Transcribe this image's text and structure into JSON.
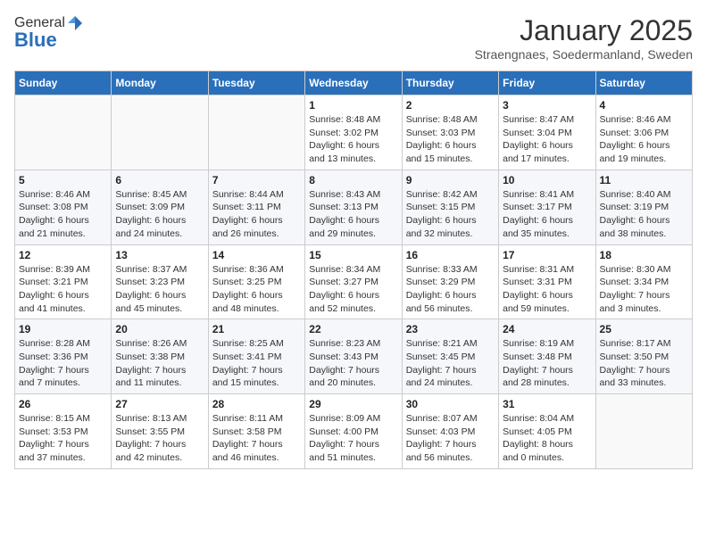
{
  "logo": {
    "general": "General",
    "blue": "Blue"
  },
  "title": "January 2025",
  "location": "Straengnaes, Soedermanland, Sweden",
  "weekdays": [
    "Sunday",
    "Monday",
    "Tuesday",
    "Wednesday",
    "Thursday",
    "Friday",
    "Saturday"
  ],
  "weeks": [
    [
      {
        "day": "",
        "info": ""
      },
      {
        "day": "",
        "info": ""
      },
      {
        "day": "",
        "info": ""
      },
      {
        "day": "1",
        "info": "Sunrise: 8:48 AM\nSunset: 3:02 PM\nDaylight: 6 hours\nand 13 minutes."
      },
      {
        "day": "2",
        "info": "Sunrise: 8:48 AM\nSunset: 3:03 PM\nDaylight: 6 hours\nand 15 minutes."
      },
      {
        "day": "3",
        "info": "Sunrise: 8:47 AM\nSunset: 3:04 PM\nDaylight: 6 hours\nand 17 minutes."
      },
      {
        "day": "4",
        "info": "Sunrise: 8:46 AM\nSunset: 3:06 PM\nDaylight: 6 hours\nand 19 minutes."
      }
    ],
    [
      {
        "day": "5",
        "info": "Sunrise: 8:46 AM\nSunset: 3:08 PM\nDaylight: 6 hours\nand 21 minutes."
      },
      {
        "day": "6",
        "info": "Sunrise: 8:45 AM\nSunset: 3:09 PM\nDaylight: 6 hours\nand 24 minutes."
      },
      {
        "day": "7",
        "info": "Sunrise: 8:44 AM\nSunset: 3:11 PM\nDaylight: 6 hours\nand 26 minutes."
      },
      {
        "day": "8",
        "info": "Sunrise: 8:43 AM\nSunset: 3:13 PM\nDaylight: 6 hours\nand 29 minutes."
      },
      {
        "day": "9",
        "info": "Sunrise: 8:42 AM\nSunset: 3:15 PM\nDaylight: 6 hours\nand 32 minutes."
      },
      {
        "day": "10",
        "info": "Sunrise: 8:41 AM\nSunset: 3:17 PM\nDaylight: 6 hours\nand 35 minutes."
      },
      {
        "day": "11",
        "info": "Sunrise: 8:40 AM\nSunset: 3:19 PM\nDaylight: 6 hours\nand 38 minutes."
      }
    ],
    [
      {
        "day": "12",
        "info": "Sunrise: 8:39 AM\nSunset: 3:21 PM\nDaylight: 6 hours\nand 41 minutes."
      },
      {
        "day": "13",
        "info": "Sunrise: 8:37 AM\nSunset: 3:23 PM\nDaylight: 6 hours\nand 45 minutes."
      },
      {
        "day": "14",
        "info": "Sunrise: 8:36 AM\nSunset: 3:25 PM\nDaylight: 6 hours\nand 48 minutes."
      },
      {
        "day": "15",
        "info": "Sunrise: 8:34 AM\nSunset: 3:27 PM\nDaylight: 6 hours\nand 52 minutes."
      },
      {
        "day": "16",
        "info": "Sunrise: 8:33 AM\nSunset: 3:29 PM\nDaylight: 6 hours\nand 56 minutes."
      },
      {
        "day": "17",
        "info": "Sunrise: 8:31 AM\nSunset: 3:31 PM\nDaylight: 6 hours\nand 59 minutes."
      },
      {
        "day": "18",
        "info": "Sunrise: 8:30 AM\nSunset: 3:34 PM\nDaylight: 7 hours\nand 3 minutes."
      }
    ],
    [
      {
        "day": "19",
        "info": "Sunrise: 8:28 AM\nSunset: 3:36 PM\nDaylight: 7 hours\nand 7 minutes."
      },
      {
        "day": "20",
        "info": "Sunrise: 8:26 AM\nSunset: 3:38 PM\nDaylight: 7 hours\nand 11 minutes."
      },
      {
        "day": "21",
        "info": "Sunrise: 8:25 AM\nSunset: 3:41 PM\nDaylight: 7 hours\nand 15 minutes."
      },
      {
        "day": "22",
        "info": "Sunrise: 8:23 AM\nSunset: 3:43 PM\nDaylight: 7 hours\nand 20 minutes."
      },
      {
        "day": "23",
        "info": "Sunrise: 8:21 AM\nSunset: 3:45 PM\nDaylight: 7 hours\nand 24 minutes."
      },
      {
        "day": "24",
        "info": "Sunrise: 8:19 AM\nSunset: 3:48 PM\nDaylight: 7 hours\nand 28 minutes."
      },
      {
        "day": "25",
        "info": "Sunrise: 8:17 AM\nSunset: 3:50 PM\nDaylight: 7 hours\nand 33 minutes."
      }
    ],
    [
      {
        "day": "26",
        "info": "Sunrise: 8:15 AM\nSunset: 3:53 PM\nDaylight: 7 hours\nand 37 minutes."
      },
      {
        "day": "27",
        "info": "Sunrise: 8:13 AM\nSunset: 3:55 PM\nDaylight: 7 hours\nand 42 minutes."
      },
      {
        "day": "28",
        "info": "Sunrise: 8:11 AM\nSunset: 3:58 PM\nDaylight: 7 hours\nand 46 minutes."
      },
      {
        "day": "29",
        "info": "Sunrise: 8:09 AM\nSunset: 4:00 PM\nDaylight: 7 hours\nand 51 minutes."
      },
      {
        "day": "30",
        "info": "Sunrise: 8:07 AM\nSunset: 4:03 PM\nDaylight: 7 hours\nand 56 minutes."
      },
      {
        "day": "31",
        "info": "Sunrise: 8:04 AM\nSunset: 4:05 PM\nDaylight: 8 hours\nand 0 minutes."
      },
      {
        "day": "",
        "info": ""
      }
    ]
  ]
}
